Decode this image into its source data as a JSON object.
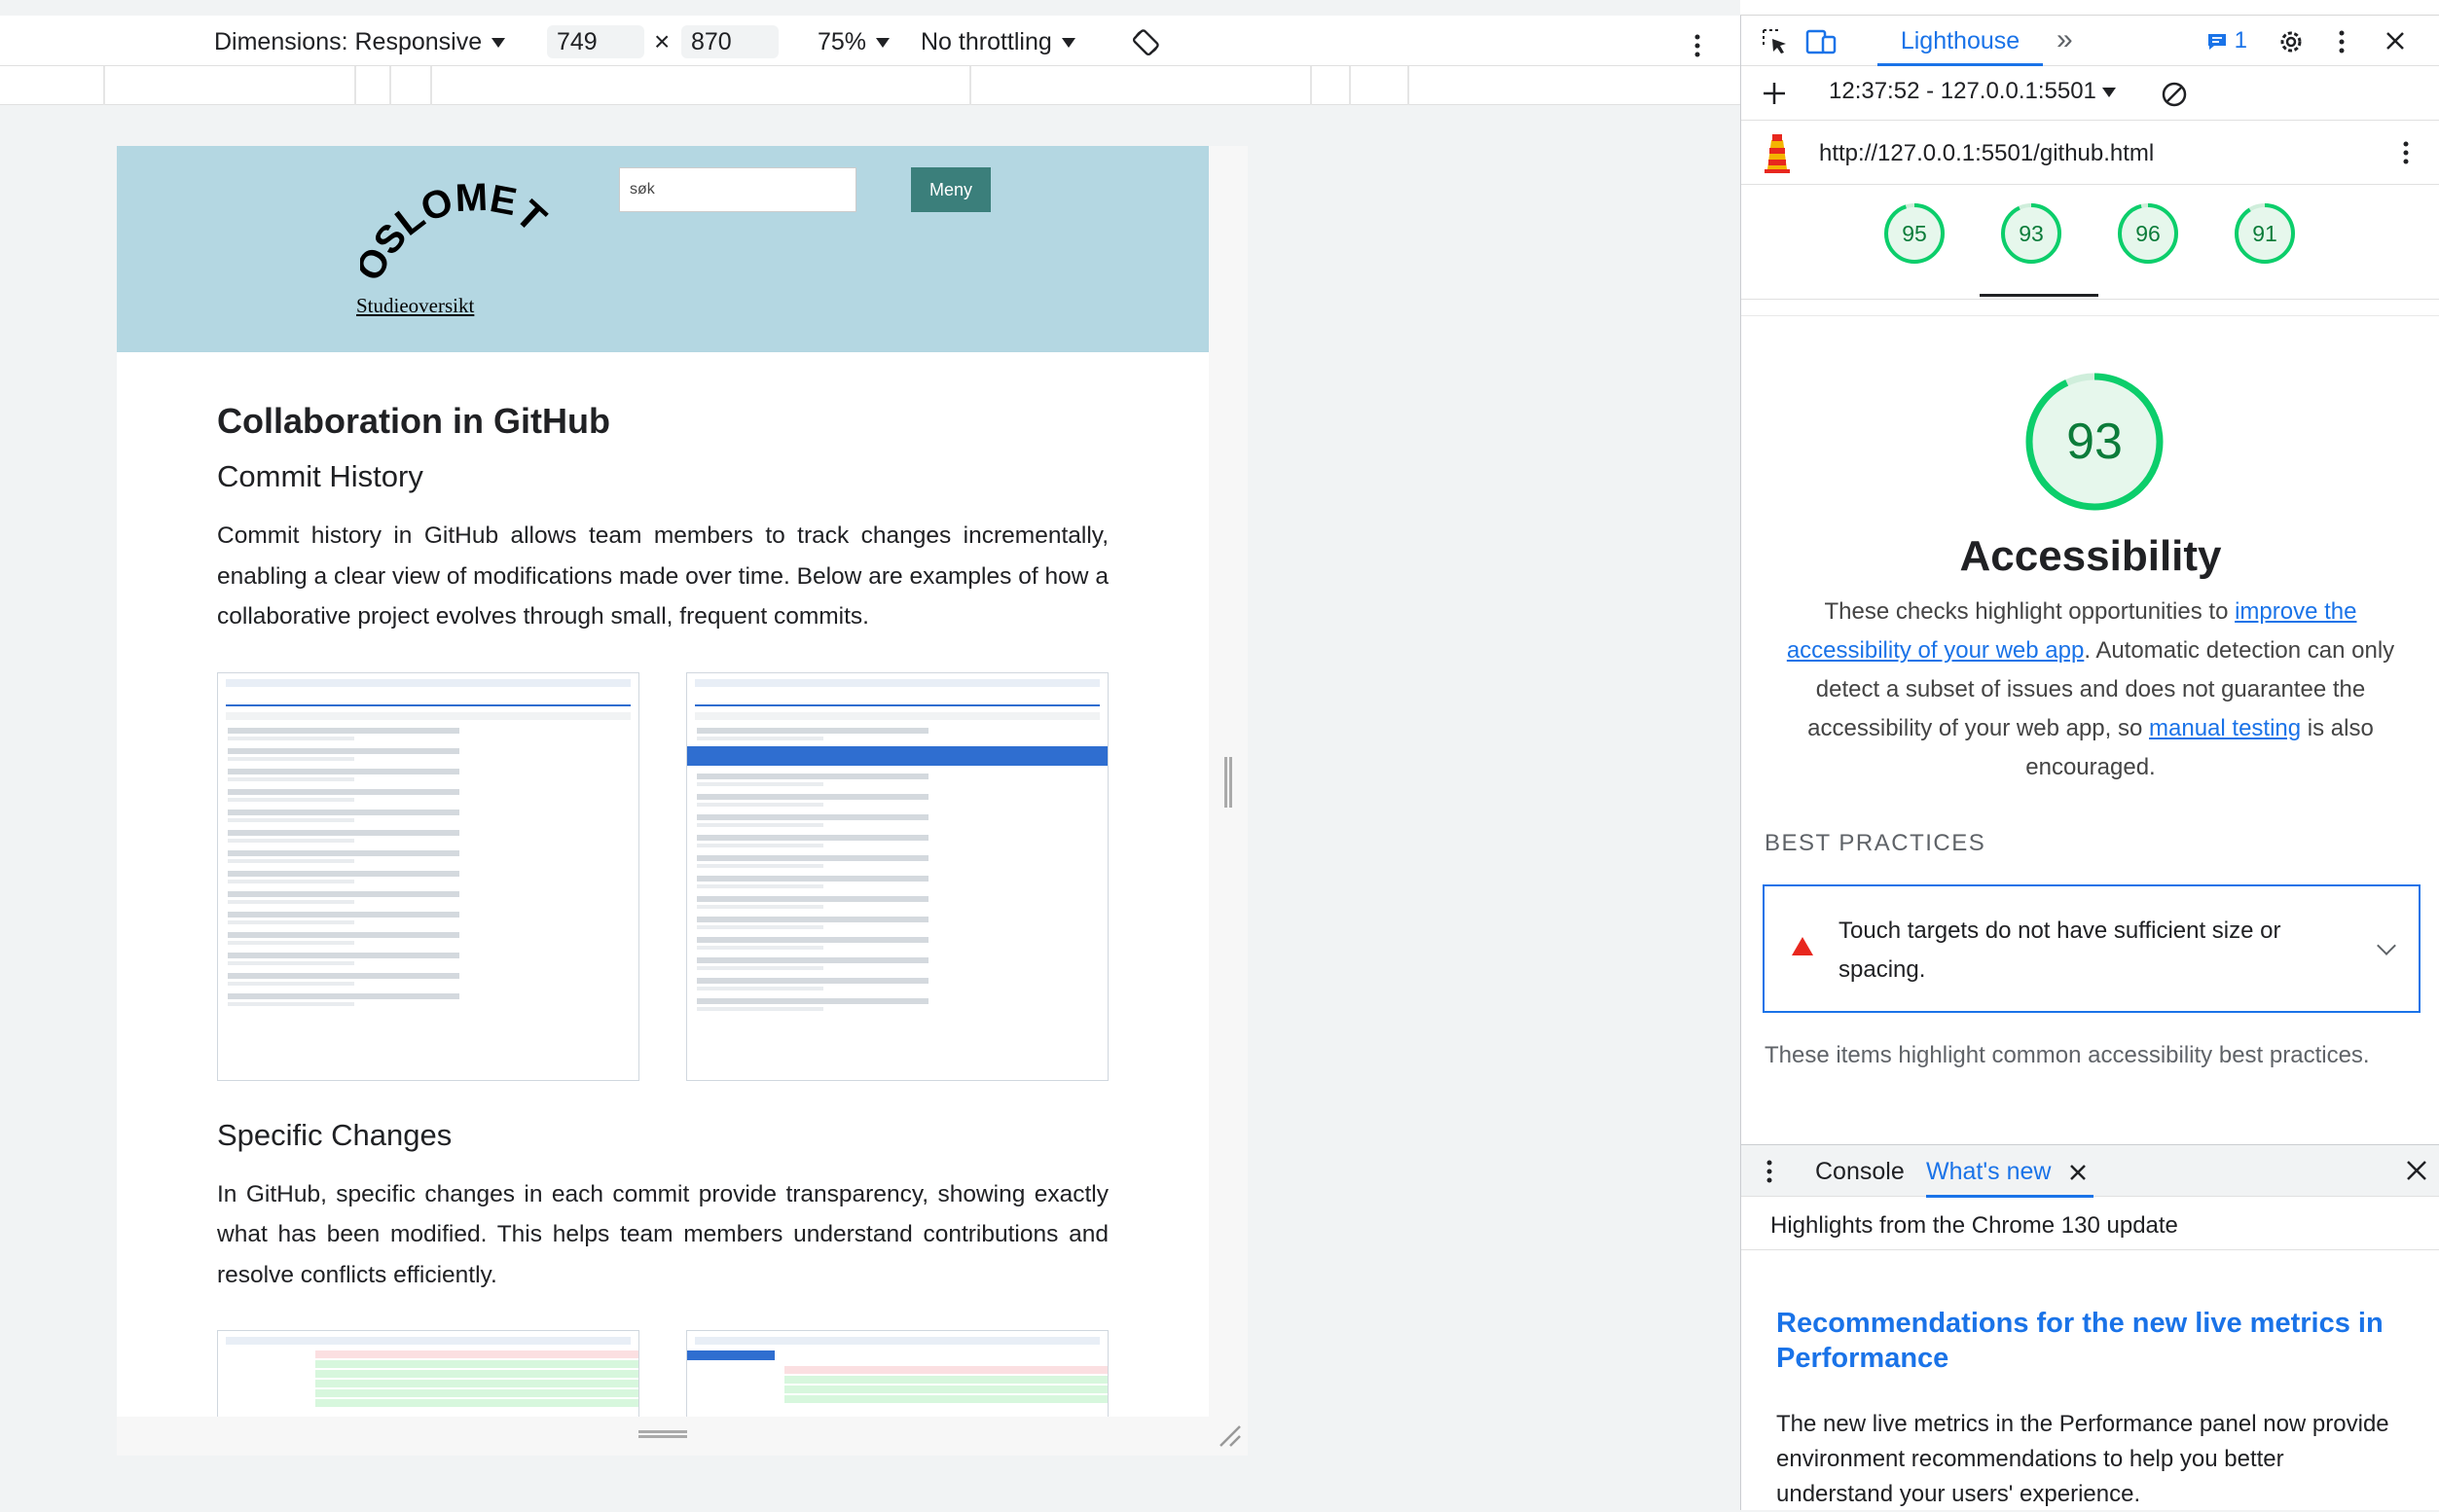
{
  "device_toolbar": {
    "dimensions_label": "Dimensions: Responsive",
    "width": "749",
    "times": "×",
    "height": "870",
    "zoom": "75%",
    "throttling": "No throttling"
  },
  "site": {
    "logo_text": "OSLOMET",
    "studie_link": "Studieoversikt",
    "search_placeholder": "søk",
    "menu_button": "Meny",
    "title": "Collaboration in GitHub",
    "section1_heading": "Commit History",
    "section1_body": "Commit history in GitHub allows team members to track changes incrementally, enabling a clear view of modifications made over time. Below are examples of how a collaborative project evolves through small, frequent commits.",
    "section2_heading": "Specific Changes",
    "section2_body": "In GitHub, specific changes in each commit provide transparency, showing exactly what has been modified. This helps team members understand contributions and resolve conflicts efficiently."
  },
  "devtools": {
    "active_tab": "Lighthouse",
    "more_tabs": "»",
    "issues_count": "1",
    "report_selector": "12:37:52 - 127.0.0.1:5501",
    "url": "http://127.0.0.1:5501/github.html",
    "scores": [
      "95",
      "93",
      "96",
      "91"
    ],
    "score_values": [
      95,
      93,
      96,
      91
    ],
    "category": {
      "score": "93",
      "score_value": 93,
      "title": "Accessibility",
      "desc_1": "These checks highlight opportunities to ",
      "desc_link1": "improve the accessibility of your web app",
      "desc_2": ". Automatic detection can only detect a subset of issues and does not guarantee the accessibility of your web app, so ",
      "desc_link2": "manual testing",
      "desc_3": " is also encouraged."
    },
    "best_practices": {
      "heading": "BEST PRACTICES",
      "audit": "Touch targets do not have sufficient size or spacing.",
      "description": "These items highlight common accessibility best practices."
    },
    "drawer": {
      "console_tab": "Console",
      "whatsnew_tab": "What's new",
      "highlights": "Highlights from the Chrome 130 update",
      "rec_title": "Recommendations for the new live metrics in Performance",
      "rec_body": "The new live metrics in the Performance panel now provide environment recommendations to help you better understand your users' experience."
    }
  },
  "colors": {
    "header_bg": "#b4d7e2",
    "menu_button": "#3b7f7b",
    "devtools_accent": "#1a73e8",
    "gauge_pass": "#0cce6b",
    "audit_fail": "#e8271e"
  },
  "icons": [
    "caret-down-icon",
    "rotate-icon",
    "kebab-icon",
    "inspect-icon",
    "device-toggle-icon",
    "issues-icon",
    "gear-icon",
    "close-icon",
    "plus-icon",
    "clear-icon",
    "lighthouse-icon",
    "warning-triangle-icon",
    "chevron-down-icon"
  ]
}
